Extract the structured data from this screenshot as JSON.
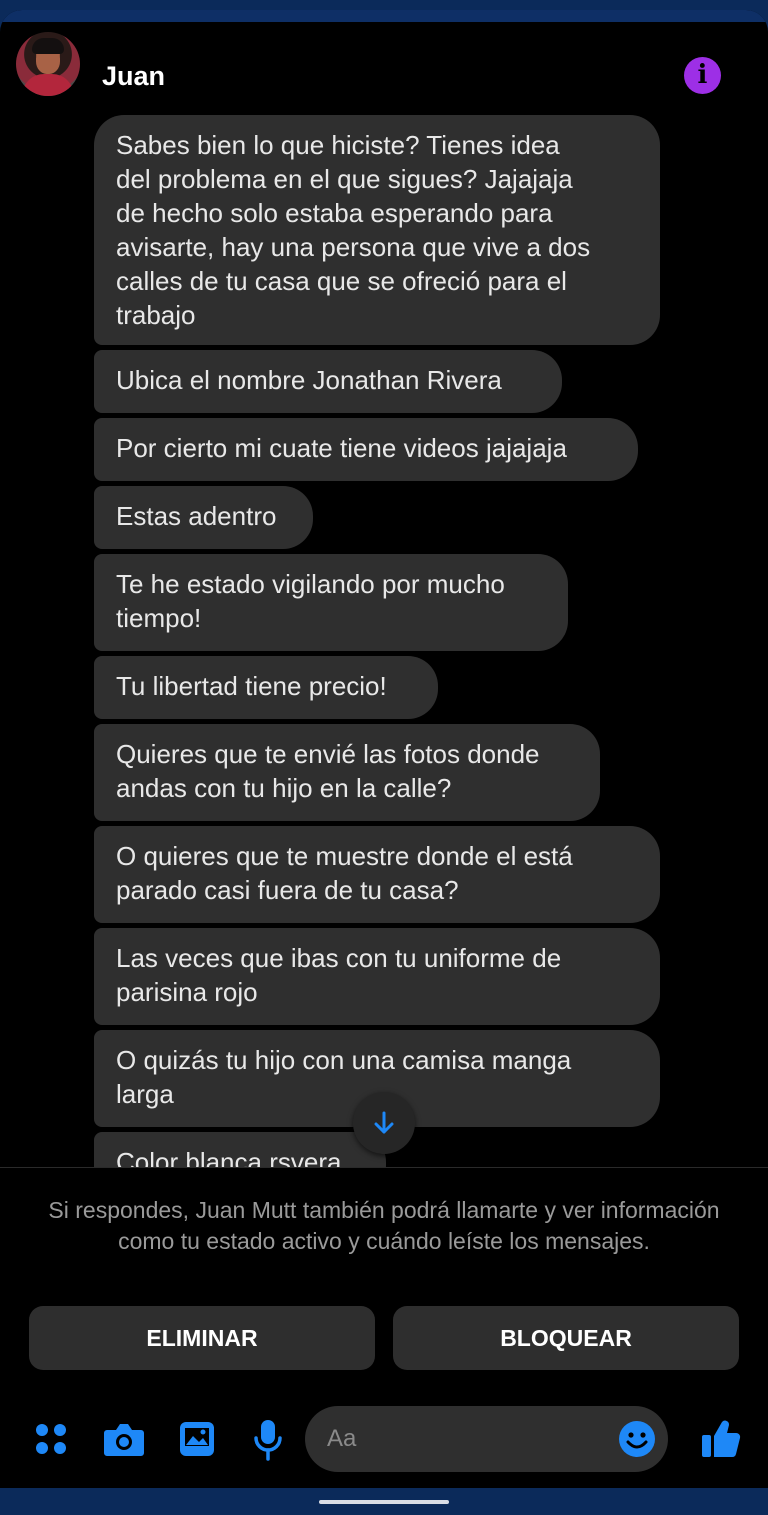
{
  "header": {
    "contact_name": "Juan",
    "info_icon": "info-icon",
    "info_color": "#9d2fe6"
  },
  "messages": [
    "Sabes bien lo que hiciste? Tienes idea\ndel problema en el que sigues? Jajajaja\nde hecho solo estaba esperando para\navisarte, hay una persona que vive a dos\ncalles de tu casa que se ofreció para el\ntrabajo",
    "Ubica el nombre Jonathan Rivera",
    "Por cierto mi cuate tiene videos jajajaja",
    "Estas adentro",
    "Te he estado vigilando por mucho\ntiempo!",
    "Tu libertad tiene precio!",
    "Quieres que te envié las fotos donde\nandas con tu hijo en la calle?",
    "O quieres que te muestre donde el está\nparado casi fuera de tu casa?",
    "Las veces que ibas con tu uniforme de\nparisina rojo",
    "O quizás tu hijo con una camisa manga\nlarga",
    "Color blanca rsvera"
  ],
  "notice": "Si respondes, Juan Mutt también podrá llamarte y ver información como tu estado activo y cuándo leíste los mensajes.",
  "actions": {
    "delete_label": "ELIMINAR",
    "block_label": "BLOQUEAR"
  },
  "composer": {
    "placeholder": "Aa",
    "icons": [
      "apps-icon",
      "camera-icon",
      "gallery-icon",
      "microphone-icon",
      "emoji-icon",
      "thumbs-up-icon"
    ],
    "accent_color": "#1e88f7"
  }
}
